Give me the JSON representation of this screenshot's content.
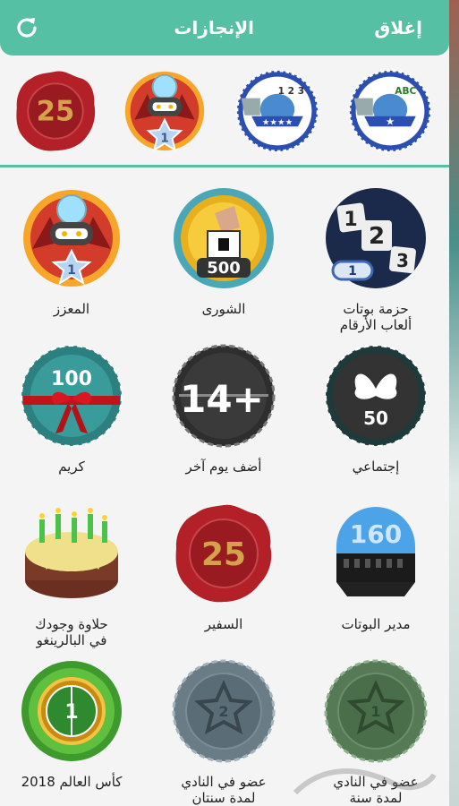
{
  "header": {
    "title": "الإنجازات",
    "close_label": "إغلاق",
    "refresh_icon": "refresh-icon"
  },
  "featured": [
    {
      "name": "wax-seal-25",
      "text": "25"
    },
    {
      "name": "robot-star-badge",
      "text": "1"
    },
    {
      "name": "bot-123-badge",
      "text": "1 2 3"
    },
    {
      "name": "bot-abc-badge",
      "text": "ABC"
    }
  ],
  "achievements": [
    {
      "label": "حزمة بوتات\nألعاب الأرقام",
      "icon": "number-tiles-icon",
      "badge_text": "1"
    },
    {
      "label": "الشورى",
      "icon": "ballot-icon",
      "badge_text": "500"
    },
    {
      "label": "المعزز",
      "icon": "robot-badge-icon",
      "badge_text": "1"
    },
    {
      "label": "إجتماعي",
      "icon": "butterfly-icon",
      "badge_text": "50"
    },
    {
      "label": "أضف يوم آخر",
      "icon": "plus-days-icon",
      "badge_text": "14+"
    },
    {
      "label": "كريم",
      "icon": "gift-ribbon-icon",
      "badge_text": "100"
    },
    {
      "label": "مدير البوتات",
      "icon": "bot-manager-icon",
      "badge_text": "160"
    },
    {
      "label": "السفير",
      "icon": "wax-seal-icon",
      "badge_text": "25"
    },
    {
      "label": "حلاوة وجودك\nفي البالرينغو",
      "icon": "cake-icon",
      "badge_text": ""
    },
    {
      "label": "عضو في النادي\nلمدة سنة",
      "icon": "club-member-1-icon",
      "badge_text": "1"
    },
    {
      "label": "عضو في النادي\nلمدة سنتان",
      "icon": "club-member-2-icon",
      "badge_text": "2"
    },
    {
      "label": "كأس العالم 2018",
      "icon": "world-cup-icon",
      "badge_text": "1"
    }
  ],
  "colors": {
    "header": "#55c0a4",
    "panel": "#f4f4f4",
    "text": "#222222"
  }
}
